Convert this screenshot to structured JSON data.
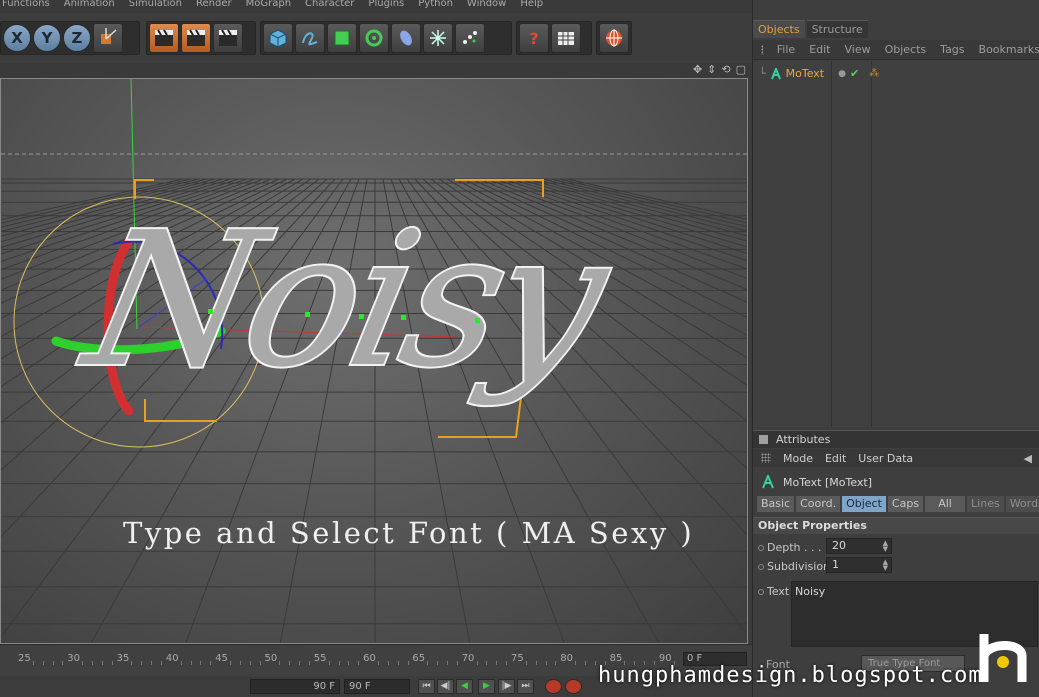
{
  "menubar": {
    "items": [
      "Functions",
      "Animation",
      "Simulation",
      "Render",
      "MoGraph",
      "Character",
      "Plugins",
      "Python",
      "Window",
      "Help"
    ]
  },
  "toolbar": {
    "axis_x": "X",
    "axis_y": "Y",
    "axis_z": "Z",
    "help_icon_text": "?"
  },
  "viewport": {
    "caption": "Type and Select Font ( MA Sexy )",
    "text_object": "Noisy",
    "colors": {
      "x_axis": "#d23030",
      "y_axis": "#2ed02e",
      "z_axis": "#2b2bb8",
      "selection": "#e8a020",
      "circle": "#d8c060"
    }
  },
  "timeline": {
    "ticks": [
      "25",
      "30",
      "35",
      "40",
      "45",
      "50",
      "55",
      "60",
      "65",
      "70",
      "75",
      "80",
      "85",
      "90"
    ],
    "current_frame": "0 F",
    "end_frame_left": "90 F",
    "end_frame_right": "90 F"
  },
  "objects_panel": {
    "tabs": [
      "Objects",
      "Structure"
    ],
    "menu": [
      "File",
      "Edit",
      "View",
      "Objects",
      "Tags",
      "Bookmarks"
    ],
    "object_name": "MoText"
  },
  "attributes_panel": {
    "title": "Attributes",
    "menu": [
      "Mode",
      "Edit",
      "User Data"
    ],
    "object_header": "MoText [MoText]",
    "tabs": [
      "Basic",
      "Coord.",
      "Object",
      "Caps",
      "All",
      "Lines",
      "Words"
    ],
    "active_tab": "Object",
    "section": "Object Properties",
    "depth_label": "Depth . . . .",
    "depth_value": "20",
    "subdivision_label": "Subdivision",
    "subdivision_value": "1",
    "text_label": "Text",
    "text_value": "Noisy",
    "font_label": "Font",
    "font_type": "True Type Font"
  },
  "watermark": {
    "text": "hungphamdesign.blogspot.com",
    "accent": "#f2c800"
  }
}
